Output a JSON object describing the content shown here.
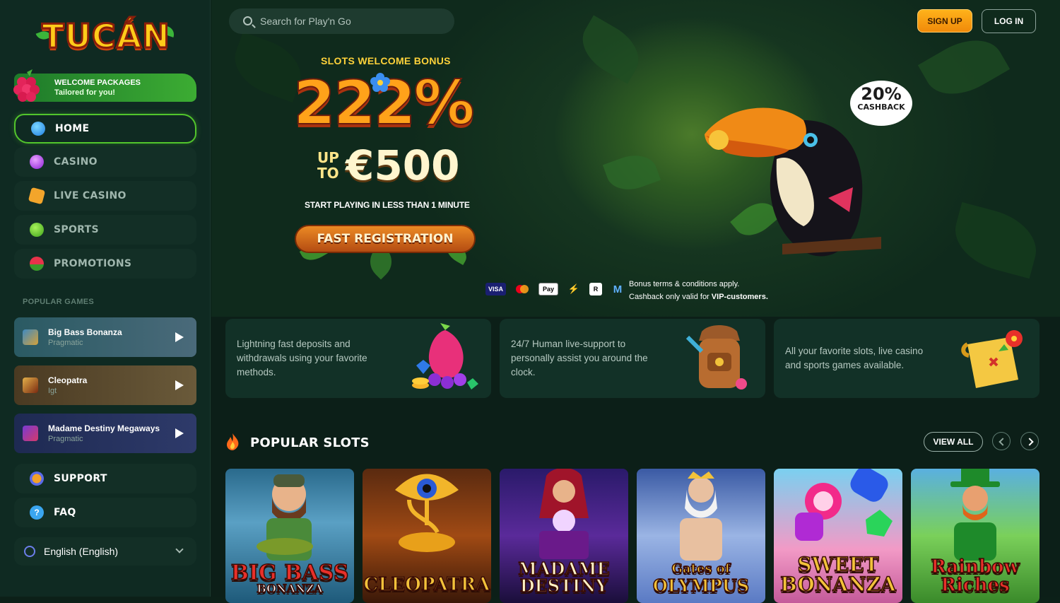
{
  "brand": {
    "logo_text": "TUCÁN"
  },
  "welcome_banner": {
    "title": "WELCOME PACKAGES",
    "subtitle": "Tailored for you!"
  },
  "nav": [
    {
      "label": "HOME",
      "icon": "blue-egg-icon",
      "active": true
    },
    {
      "label": "CASINO",
      "icon": "purple-gem-icon",
      "active": false
    },
    {
      "label": "LIVE CASINO",
      "icon": "dice-icon",
      "active": false
    },
    {
      "label": "SPORTS",
      "icon": "tennis-ball-icon",
      "active": false
    },
    {
      "label": "PROMOTIONS",
      "icon": "watermelon-icon",
      "active": false
    }
  ],
  "popular_games_label": "POPULAR GAMES",
  "popular_games": [
    {
      "name": "Big Bass Bonanza",
      "provider": "Pragmatic"
    },
    {
      "name": "Cleopatra",
      "provider": "Igt"
    },
    {
      "name": "Madame Destiny Megaways",
      "provider": "Pragmatic"
    }
  ],
  "support": {
    "support_label": "SUPPORT",
    "faq_label": "FAQ"
  },
  "language": {
    "selected": "English (English)"
  },
  "header": {
    "search_placeholder": "Search for Play'n Go",
    "signup_label": "SIGN UP",
    "login_label": "LOG IN"
  },
  "hero": {
    "kicker": "SLOTS WELCOME BONUS",
    "percent": "222%",
    "up_to_line1": "UP",
    "up_to_line2": "TO",
    "amount": "€500",
    "note": "START PLAYING IN LESS THAN 1 MINUTE",
    "cta": "FAST REGISTRATION",
    "cashback_pct": "20%",
    "cashback_label": "CASHBACK",
    "payments": [
      "VISA",
      "mastercard-icon",
      "Pay",
      "skrill-icon",
      "R",
      "M"
    ],
    "terms_line1": "Bonus terms & conditions apply.",
    "terms_line2_prefix": "Cashback only valid for",
    "terms_line2_bold": "VIP-customers."
  },
  "features": [
    {
      "text": "Lightning fast deposits and withdrawals using your favorite methods.",
      "icon": "dragonfruit-gems-icon"
    },
    {
      "text": "24/7 Human live-support to personally assist you around the clock.",
      "icon": "backpack-icon"
    },
    {
      "text": "All your favorite slots, live casino and sports games available.",
      "icon": "treasure-map-icon"
    }
  ],
  "popular_slots": {
    "title": "POPULAR SLOTS",
    "view_all": "VIEW ALL",
    "games": [
      {
        "title_line1": "BIG BASS",
        "title_line2": "BONANZA"
      },
      {
        "title_line1": "CLEOPATRA",
        "title_line2": ""
      },
      {
        "title_line1": "MADAME",
        "title_line2": "DESTINY"
      },
      {
        "title_line1": "Gates of",
        "title_line2": "OLYMPUS"
      },
      {
        "title_line1": "SWEET",
        "title_line2": "BONANZA"
      },
      {
        "title_line1": "Rainbow",
        "title_line2": "Riches"
      }
    ]
  },
  "colors": {
    "accent_green": "#52c52c",
    "signup_orange": "#f5a014",
    "bg": "#0c1f18"
  }
}
